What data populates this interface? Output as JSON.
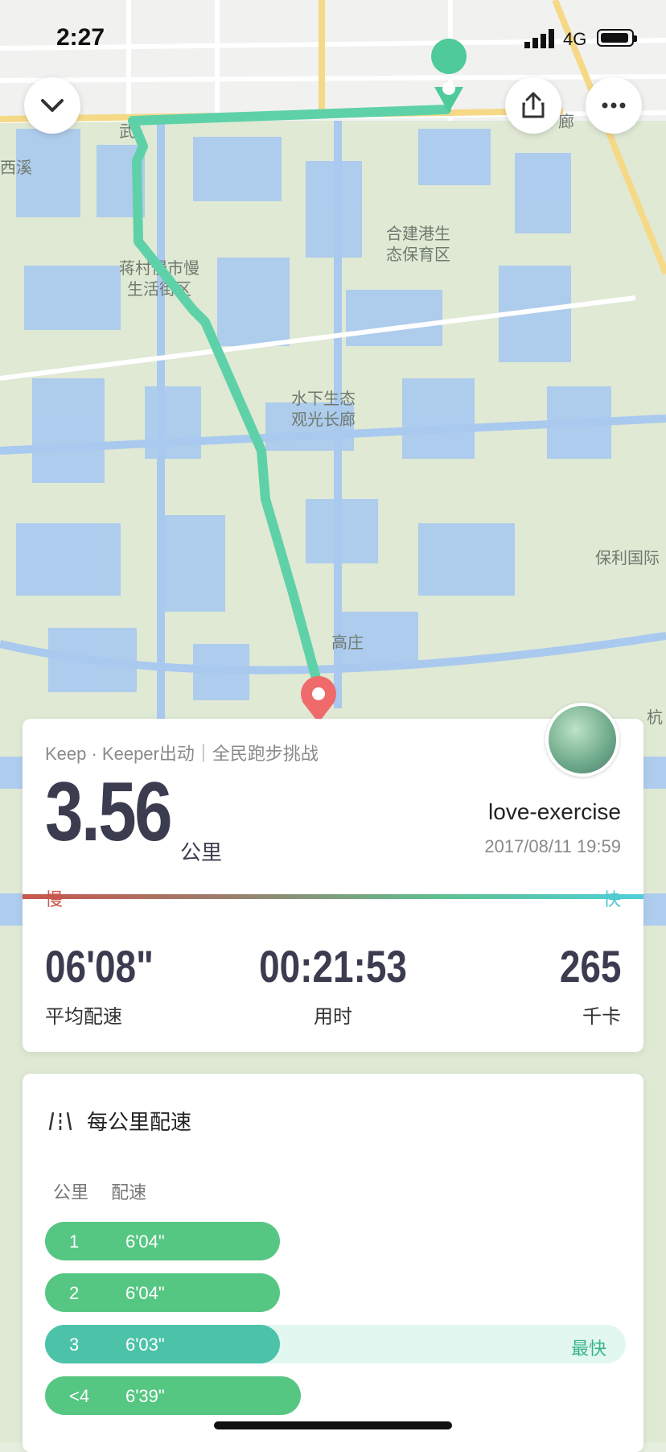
{
  "status_bar": {
    "time": "2:27",
    "network": "4G"
  },
  "map": {
    "labels": [
      "西溪",
      "蒋村慢市慢",
      "生活街区",
      "合建港生",
      "态保育区",
      "水下生态",
      "观光长廊",
      "保利国际",
      "高庄",
      "杭",
      "廊",
      "武"
    ]
  },
  "actions": {
    "collapse_icon": "chevron-down-icon",
    "share_icon": "share-icon",
    "more_icon": "more-icon"
  },
  "summary": {
    "subtitle": "Keep · Keeper出动｜全民跑步挑战",
    "distance": "3.56",
    "unit": "公里",
    "username": "love-exercise",
    "datetime": "2017/08/11 19:59",
    "slow_label": "慢",
    "fast_label": "快",
    "stats": [
      {
        "value": "06'08\"",
        "label": "平均配速"
      },
      {
        "value": "00:21:53",
        "label": "用时"
      },
      {
        "value": "265",
        "label": "千卡"
      }
    ]
  },
  "splits": {
    "title": "每公里配速",
    "col_km": "公里",
    "col_pace": "配速",
    "rows": [
      {
        "km": "1",
        "pace": "6'04\"",
        "level": 0.405,
        "tag": ""
      },
      {
        "km": "2",
        "pace": "6'04\"",
        "level": 0.405,
        "tag": ""
      },
      {
        "km": "3",
        "pace": "6'03\"",
        "level": 0.405,
        "tag": "最快"
      },
      {
        "km": "<4",
        "pace": "6'39\"",
        "level": 0.44,
        "tag": ""
      }
    ]
  }
}
